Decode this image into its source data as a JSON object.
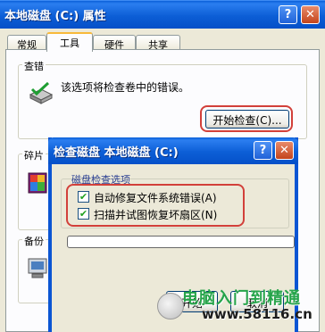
{
  "properties_window": {
    "title": "本地磁盘 (C:) 属性",
    "help_glyph": "?",
    "close_glyph": "✕",
    "tabs": [
      {
        "label": "常规"
      },
      {
        "label": "工具"
      },
      {
        "label": "硬件"
      },
      {
        "label": "共享"
      }
    ],
    "active_tab": "工具",
    "error_check": {
      "group_label": "查错",
      "description": "该选项将检查卷中的错误。",
      "button_label": "开始检查(C)...",
      "icon": "disk-check-icon"
    },
    "defrag": {
      "group_label_fragment": "碎片",
      "icon": "defrag-icon"
    },
    "backup": {
      "group_label_fragment": "备份",
      "icon": "backup-icon"
    }
  },
  "check_disk_dialog": {
    "title": "检查磁盘 本地磁盘 (C:)",
    "help_glyph": "?",
    "close_glyph": "✕",
    "group_label": "磁盘检查选项",
    "options": [
      {
        "label": "自动修复文件系统错误(A)",
        "checked": true
      },
      {
        "label": "扫描并试图恢复坏扇区(N)",
        "checked": true
      }
    ],
    "progress": 0,
    "start_button_fragment": "开始",
    "cancel_button_label": "取消"
  },
  "watermark": {
    "title": "电脑入门到精通",
    "url": "www.58116.cn"
  },
  "colors": {
    "titlebar_blue": "#0c5ed6",
    "highlight_ring": "#d2403a",
    "progress_green": "#2fb131",
    "watermark_green": "#26a44a"
  }
}
